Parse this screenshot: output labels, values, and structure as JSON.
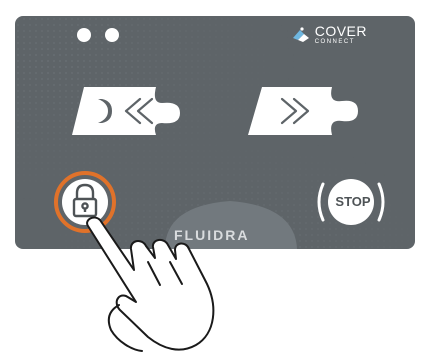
{
  "brand": {
    "logo_name": "cover-connect-logo",
    "cover": "COVER",
    "connect": "CONNECT",
    "maker": "FLUIDRA"
  },
  "controls": {
    "open_icon": "chevrons-left-icon",
    "close_icon": "chevrons-right-icon",
    "lock_icon": "padlock-icon",
    "stop_label": "STOP"
  },
  "indicators": {
    "led_count": 2
  },
  "colors": {
    "panel": "#5e6468",
    "panel_text": "#ffffff",
    "lock_ring": "#e0722a",
    "button_fill": "#ffffff",
    "hand_outline": "#1a1a1a"
  }
}
